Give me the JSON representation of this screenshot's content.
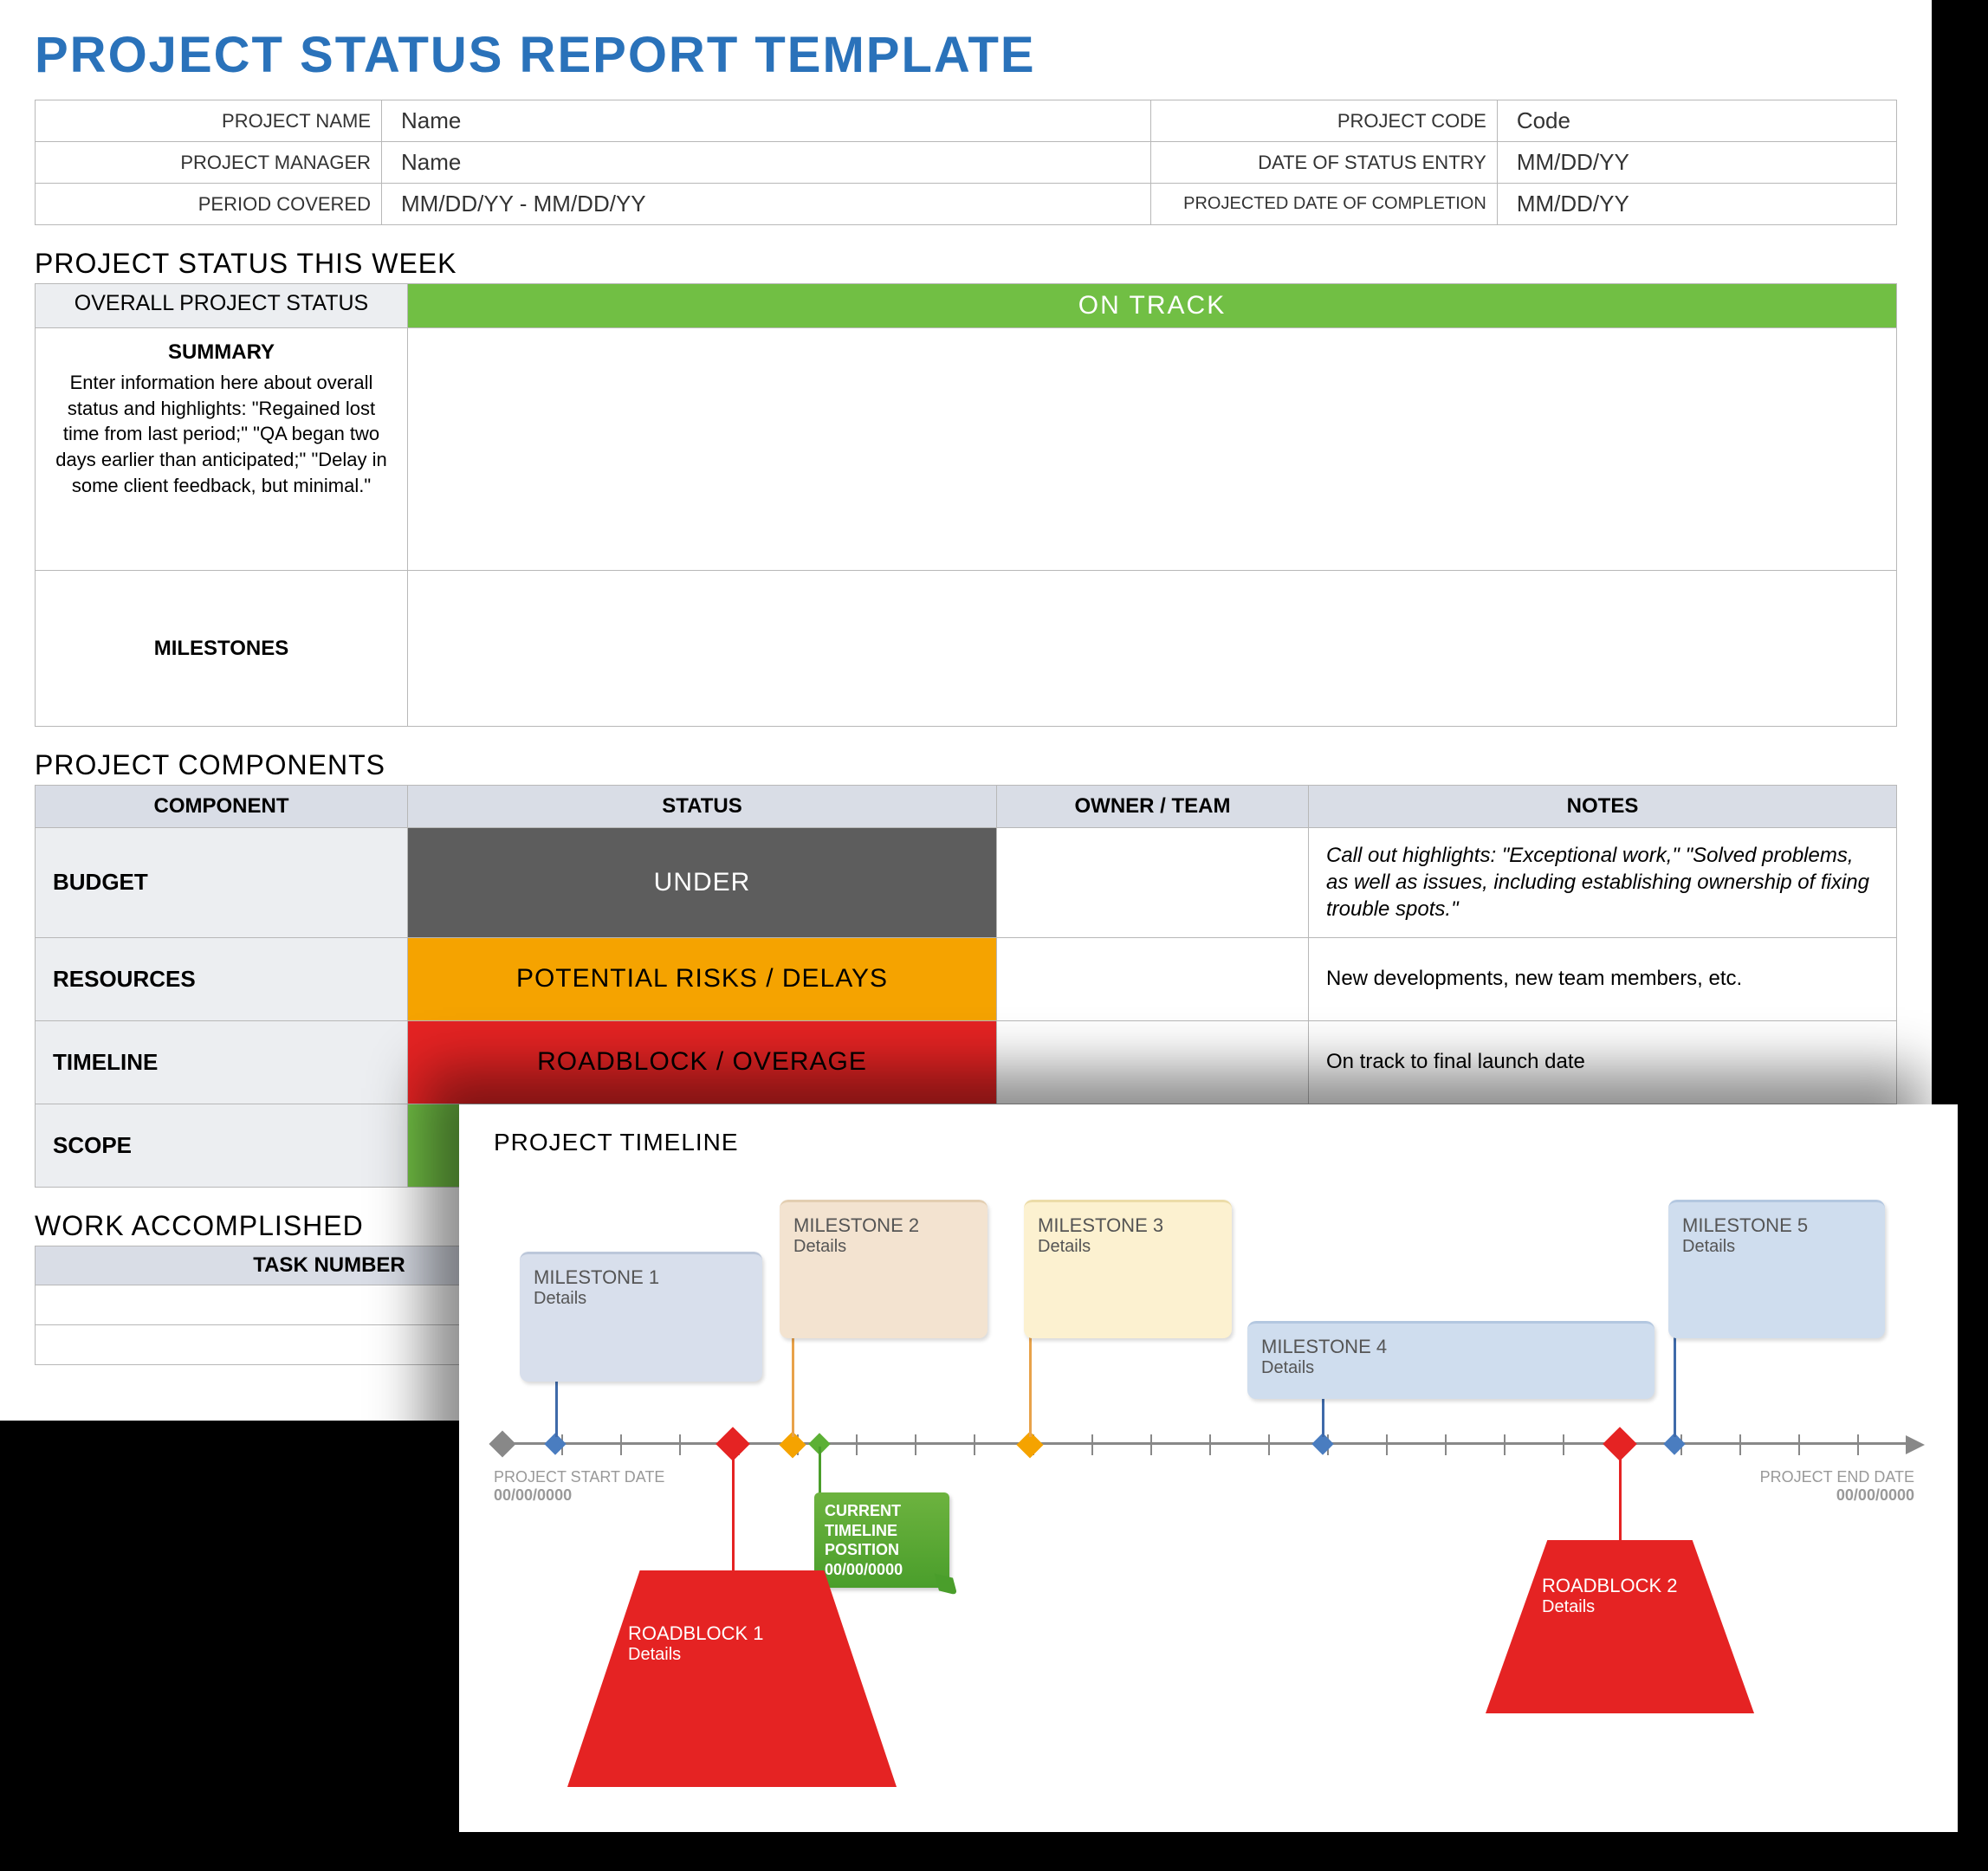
{
  "title": "PROJECT STATUS REPORT TEMPLATE",
  "info": {
    "project_name_label": "PROJECT NAME",
    "project_name": "Name",
    "project_code_label": "PROJECT CODE",
    "project_code": "Code",
    "project_manager_label": "PROJECT MANAGER",
    "project_manager": "Name",
    "date_status_label": "DATE OF STATUS ENTRY",
    "date_status": "MM/DD/YY",
    "period_covered_label": "PERIOD COVERED",
    "period_covered": "MM/DD/YY - MM/DD/YY",
    "proj_completion_label": "PROJECTED DATE OF COMPLETION",
    "proj_completion": "MM/DD/YY"
  },
  "status_week": {
    "heading": "PROJECT STATUS THIS WEEK",
    "overall_label": "OVERALL PROJECT STATUS",
    "overall_value": "ON TRACK",
    "summary_label": "SUMMARY",
    "summary_desc": "Enter information here about overall status and highlights: \"Regained lost time from last period;\" \"QA began two days earlier than anticipated;\" \"Delay in some client feedback, but minimal.\"",
    "milestones_label": "MILESTONES"
  },
  "components": {
    "heading": "PROJECT COMPONENTS",
    "cols": {
      "component": "COMPONENT",
      "status": "STATUS",
      "owner": "OWNER / TEAM",
      "notes": "NOTES"
    },
    "rows": {
      "budget": {
        "label": "BUDGET",
        "status": "UNDER",
        "color": "#5d5d5d",
        "notes": "Call out highlights: \"Exceptional work,\" \"Solved problems, as well as issues, including establishing ownership of fixing trouble spots.\""
      },
      "resources": {
        "label": "RESOURCES",
        "status": "POTENTIAL RISKS / DELAYS",
        "color": "#f5a300",
        "notes": "New developments, new team members, etc."
      },
      "timeline": {
        "label": "TIMELINE",
        "status": "ROADBLOCK / OVERAGE",
        "color": "#e52323",
        "notes": "On track to final launch date"
      },
      "scope": {
        "label": "SCOPE",
        "status": "",
        "color": "#71bf44",
        "notes": ""
      }
    }
  },
  "work": {
    "heading": "WORK ACCOMPLISHED",
    "col_task": "TASK NUMBER"
  },
  "timeline": {
    "heading": "PROJECT TIMELINE",
    "start_label": "PROJECT START DATE",
    "start_date": "00/00/0000",
    "end_label": "PROJECT END DATE",
    "end_date": "00/00/0000",
    "current_label": "CURRENT TIMELINE POSITION",
    "current_date": "00/00/0000",
    "milestones": {
      "m1": {
        "name": "MILESTONE 1",
        "det": "Details"
      },
      "m2": {
        "name": "MILESTONE 2",
        "det": "Details"
      },
      "m3": {
        "name": "MILESTONE 3",
        "det": "Details"
      },
      "m4": {
        "name": "MILESTONE 4",
        "det": "Details"
      },
      "m5": {
        "name": "MILESTONE 5",
        "det": "Details"
      }
    },
    "roadblocks": {
      "r1": {
        "name": "ROADBLOCK 1",
        "det": "Details"
      },
      "r2": {
        "name": "ROADBLOCK 2",
        "det": "Details"
      }
    }
  },
  "chart_data": {
    "type": "timeline",
    "axis_range": [
      0,
      24
    ],
    "start": {
      "label": "PROJECT START DATE",
      "date": "00/00/0000",
      "pos": 0
    },
    "end": {
      "label": "PROJECT END DATE",
      "date": "00/00/0000",
      "pos": 24
    },
    "current": {
      "label": "CURRENT TIMELINE POSITION",
      "date": "00/00/0000",
      "pos": 5.5
    },
    "milestones": [
      {
        "id": "m1",
        "name": "MILESTONE 1",
        "pos": 1,
        "color": "#d8dfec"
      },
      {
        "id": "m2",
        "name": "MILESTONE 2",
        "pos": 5,
        "color": "#f3e3d0"
      },
      {
        "id": "m3",
        "name": "MILESTONE 3",
        "pos": 9,
        "color": "#fcf1d0"
      },
      {
        "id": "m4",
        "name": "MILESTONE 4",
        "pos": 14,
        "color": "#cfddee"
      },
      {
        "id": "m5",
        "name": "MILESTONE 5",
        "pos": 20,
        "color": "#cfddee"
      }
    ],
    "roadblocks": [
      {
        "id": "r1",
        "name": "ROADBLOCK 1",
        "pos": 4.0
      },
      {
        "id": "r2",
        "name": "ROADBLOCK 2",
        "pos": 19.0
      }
    ]
  }
}
